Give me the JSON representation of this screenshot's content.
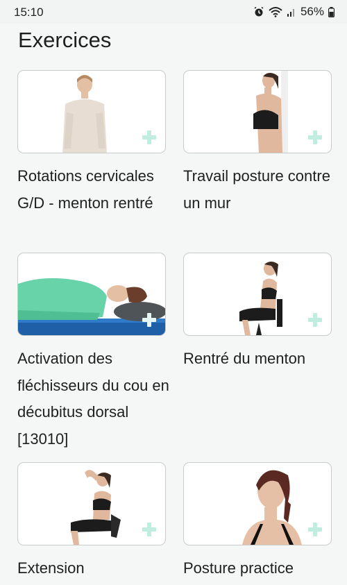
{
  "status_bar": {
    "time": "15:10",
    "battery": "56%",
    "icons": [
      "alarm-icon",
      "wifi-icon",
      "signal-icon",
      "battery-icon"
    ]
  },
  "page": {
    "title": "Exercices"
  },
  "exercises": [
    {
      "title": "Rotations cervicales G/D - menton rentré",
      "icon": "add-icon"
    },
    {
      "title": "Travail posture contre un mur",
      "icon": "add-icon"
    },
    {
      "title": "Activation des fléchisseurs du cou en décubitus dorsal [13010]",
      "icon": "add-icon"
    },
    {
      "title": "Rentré du menton",
      "icon": "add-icon"
    },
    {
      "title": "Extension",
      "icon": "add-icon"
    },
    {
      "title": "Posture practice",
      "icon": "add-icon"
    }
  ],
  "colors": {
    "background": "#f5f6f6",
    "card_border": "#c9cbcb",
    "add_icon": "#bfeee0"
  }
}
